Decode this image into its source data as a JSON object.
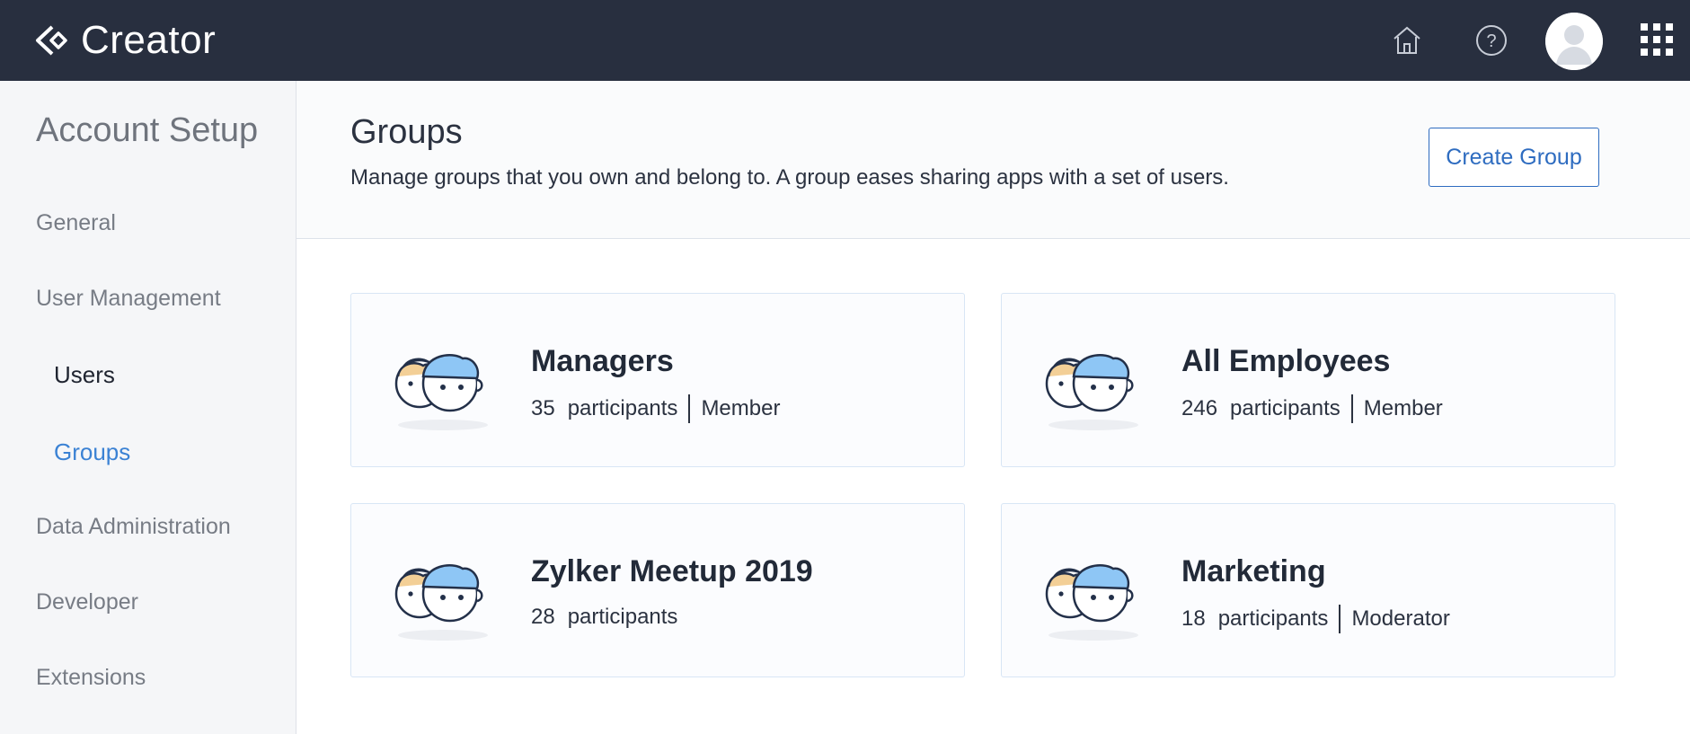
{
  "header": {
    "brand": "Creator",
    "icons": [
      "home-icon",
      "help-icon",
      "user-avatar",
      "apps-grid-icon"
    ]
  },
  "sidebar": {
    "title": "Account Setup",
    "items": [
      {
        "label": "General"
      },
      {
        "label": "User Management"
      },
      {
        "label": "Users"
      },
      {
        "label": "Groups"
      },
      {
        "label": "Data Administration"
      },
      {
        "label": "Developer"
      },
      {
        "label": "Extensions"
      }
    ]
  },
  "main": {
    "title": "Groups",
    "description": "Manage groups that you own and belong to. A group eases sharing apps with a set of users.",
    "create_label": "Create Group",
    "groups": [
      {
        "name": "Managers",
        "count": "35",
        "participants_label": "participants",
        "role": "Member"
      },
      {
        "name": "All Employees",
        "count": "246",
        "participants_label": "participants",
        "role": "Member"
      },
      {
        "name": "Zylker Meetup 2019",
        "count": "28",
        "participants_label": "participants",
        "role": ""
      },
      {
        "name": "Marketing",
        "count": "18",
        "participants_label": "participants",
        "role": "Moderator"
      }
    ]
  },
  "colors": {
    "topbar": "#282f3f",
    "accent": "#3b82d4",
    "button_border": "#2e6cc0",
    "hair_front": "#8ec6f5",
    "hair_back": "#f3cf96"
  }
}
